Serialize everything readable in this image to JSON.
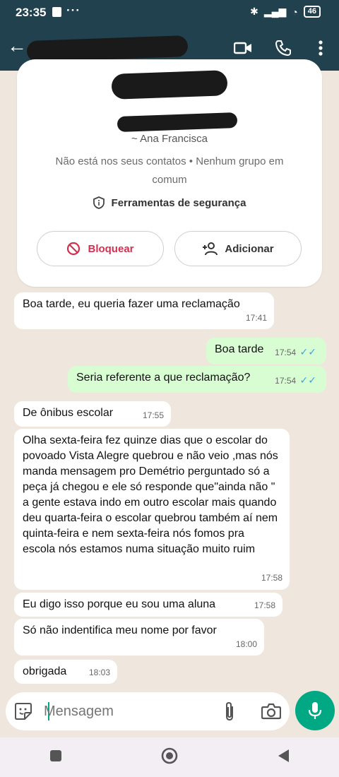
{
  "status_bar": {
    "time": "23:35",
    "dots": "···",
    "battery": "46"
  },
  "contact": {
    "name": "~ Ana Francisca",
    "info": "Não está nos seus contatos • Nenhum grupo em comum",
    "security_label": "Ferramentas de segurança",
    "block_label": "Bloquear",
    "add_label": "Adicionar"
  },
  "messages": [
    {
      "direction": "in",
      "text": "Boa tarde, eu queria fazer uma reclamação",
      "time": "17:41"
    },
    {
      "direction": "out",
      "text": "Boa tarde",
      "time": "17:54"
    },
    {
      "direction": "out",
      "text": "Seria referente a que reclamação?",
      "time": "17:54"
    },
    {
      "direction": "in",
      "text": "De ônibus  escolar",
      "time": "17:55"
    },
    {
      "direction": "in",
      "text": "Olha  sexta-feira  fez quinze dias  que o escolar do povoado  Vista Alegre  quebrou  e não  veio ,mas  nós manda mensagem  pro Demétrio  perguntado  só a peça  já chegou e  ele  só  responde que\"ainda não  \"  a gente estava indo em outro  escolar  mais quando deu quarta-feira  o escolar  quebrou  também aí nem quinta-feira  e  nem sexta-feira  nós  fomos pra escola nós estamos numa situação  muito  ruim",
      "time": "17:58"
    },
    {
      "direction": "in",
      "text": "Eu digo isso porque eu sou uma aluna",
      "time": "17:58"
    },
    {
      "direction": "in",
      "text": "Só  não  indentifica  meu nome  por favor",
      "time": "18:00"
    },
    {
      "direction": "in",
      "text": "obrigada",
      "time": "18:03"
    }
  ],
  "input": {
    "placeholder": "Mensagem"
  },
  "colors": {
    "header": "#22414f",
    "accent": "#00a884",
    "outgoing": "#d9fdd3",
    "read_ticks": "#3aa3ea",
    "block_red": "#d32f4f"
  },
  "icons": [
    "back-arrow-icon",
    "video-call-icon",
    "phone-call-icon",
    "more-vert-icon",
    "shield-icon",
    "block-icon",
    "add-person-icon",
    "sticker-icon",
    "attach-icon",
    "camera-icon",
    "mic-icon",
    "nav-recents-icon",
    "nav-home-icon",
    "nav-back-icon"
  ]
}
